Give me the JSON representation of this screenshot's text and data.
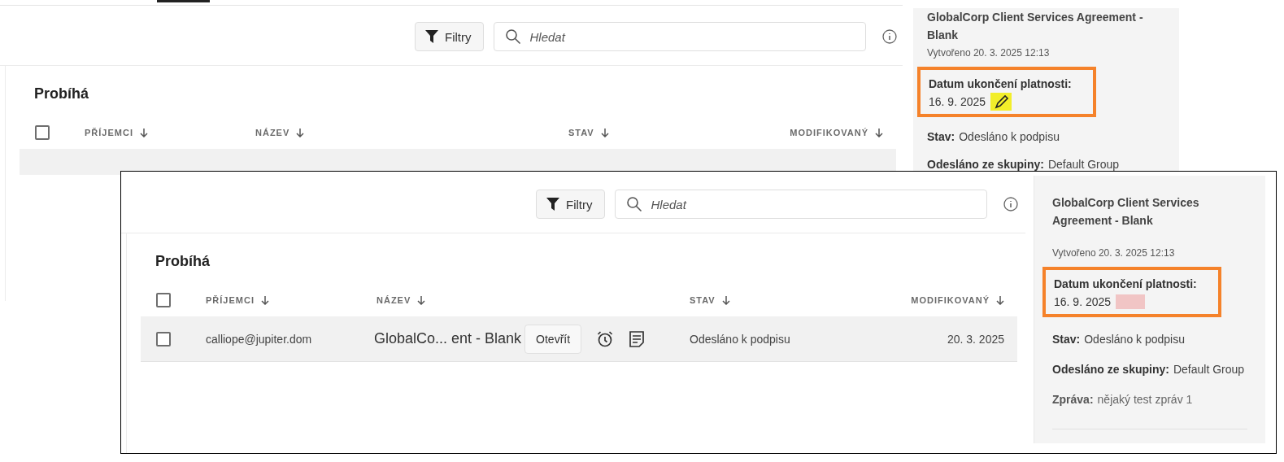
{
  "screenshots": [
    {
      "kind": "back",
      "toolbar": {
        "filter_button": "Filtry",
        "search_placeholder": "Hledat"
      },
      "section_title": "Probíhá",
      "select_all": {
        "checked": false
      },
      "columns": [
        "PŘÍJEMCI",
        "NÁZEV",
        "STAV",
        "MODIFIKOVANÝ"
      ],
      "details": {
        "title": "GlobalCorp Client Services Agreement - Blank",
        "created": "Vytvořeno 20. 3. 2025 12:13",
        "expiry_label": "Datum ukončení platnosti:",
        "expiry_value": "16. 9. 2025",
        "expiry_marker": {
          "kind": "pencil"
        },
        "fields": [
          {
            "label": "Stav:",
            "value": "Odesláno k podpisu"
          },
          {
            "label": "Odesláno ze skupiny:",
            "value": "Default Group"
          }
        ]
      }
    },
    {
      "kind": "front",
      "toolbar": {
        "filter_button": "Filtry",
        "search_placeholder": "Hledat"
      },
      "section_title": "Probíhá",
      "select_all": {
        "checked": false
      },
      "columns": [
        "PŘÍJEMCI",
        "NÁZEV",
        "STAV",
        "MODIFIKOVANÝ"
      ],
      "rows": [
        {
          "selected": false,
          "recipient": "calliope@jupiter.dom",
          "name": "GlobalCo... ent - Blank",
          "open_button": "Otevřít",
          "status": "Odesláno k podpisu",
          "modified": "20. 3. 2025"
        }
      ],
      "details": {
        "title": "GlobalCorp Client Services Agreement - Blank",
        "created": "Vytvořeno 20. 3. 2025 12:13",
        "expiry_label": "Datum ukončení platnosti:",
        "expiry_value": "16. 9. 2025",
        "expiry_marker": {
          "kind": "redaction"
        },
        "fields": [
          {
            "label": "Stav:",
            "value": "Odesláno k podpisu",
            "muted": false
          },
          {
            "label": "Odesláno ze skupiny:",
            "value": "Default Group",
            "muted": false
          },
          {
            "label": "Zpráva:",
            "value": "nějaký test zpráv 1",
            "muted": true
          }
        ]
      }
    }
  ]
}
